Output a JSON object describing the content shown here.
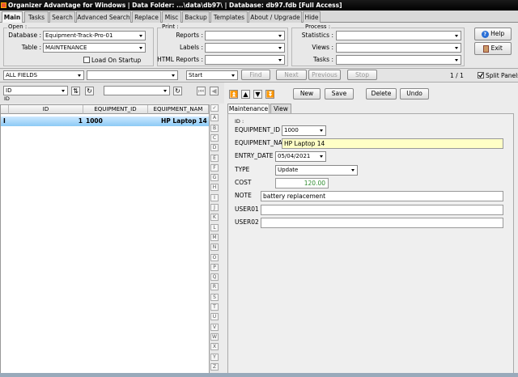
{
  "window": {
    "title": "Organizer Advantage for Windows | Data Folder: ...\\data\\db97\\ | Database: db97.fdb [Full Access]"
  },
  "main_tabs": [
    "Main",
    "Tasks",
    "Search",
    "Advanced Search",
    "Replace",
    "Misc",
    "Backup",
    "Templates",
    "About / Upgrade",
    "Hide"
  ],
  "open_group": {
    "title": "Open :",
    "database_label": "Database :",
    "database_value": "Equipment-Track-Pro-01",
    "table_label": "Table :",
    "table_value": "MAINTENANCE",
    "load_on_startup_label": "Load On Startup"
  },
  "print_group": {
    "title": "Print :",
    "reports_label": "Reports :",
    "labels_label": "Labels :",
    "html_reports_label": "HTML Reports :"
  },
  "process_group": {
    "title": "Process :",
    "statistics_label": "Statistics :",
    "views_label": "Views :",
    "tasks_label": "Tasks :"
  },
  "help_button": "Help",
  "exit_button": "Exit",
  "search": {
    "field_value": "ALL FIELDS",
    "mode_value": "Start",
    "find_button": "Find",
    "next_button": "Next",
    "previous_button": "Previous",
    "stop_button": "Stop",
    "record_counter": "1 / 1",
    "split_panels_label": "Split Panels"
  },
  "sort": {
    "field_value": "ID",
    "sub_label": "ID"
  },
  "grid": {
    "columns": [
      "ID",
      "EQUIPMENT_ID",
      "EQUIPMENT_NAM"
    ],
    "rows": [
      {
        "marker": "I",
        "id": "1",
        "equipment_id": "1000",
        "equipment_name": "HP Laptop 14"
      }
    ]
  },
  "alpha_index": [
    "✓",
    "A",
    "B",
    "C",
    "D",
    "E",
    "F",
    "G",
    "H",
    "I",
    "J",
    "K",
    "L",
    "M",
    "N",
    "O",
    "P",
    "Q",
    "R",
    "S",
    "T",
    "U",
    "V",
    "W",
    "X",
    "Y",
    "Z"
  ],
  "record_toolbar": {
    "new_button": "New",
    "save_button": "Save",
    "delete_button": "Delete",
    "undo_button": "Undo"
  },
  "form_tabs": [
    "Maintenance",
    "View"
  ],
  "form": {
    "id_label": "ID :",
    "equipment_id_label": "EQUIPMENT_ID",
    "equipment_id_value": "1000",
    "equipment_name_label": "EQUIPMENT_NA",
    "equipment_name_value": "HP Laptop 14",
    "entry_date_label": "ENTRY_DATE",
    "entry_date_value": "05/04/2021",
    "type_label": "TYPE",
    "type_value": "Update",
    "cost_label": "COST",
    "cost_value": "120.00",
    "note_label": "NOTE",
    "note_value": "battery replacement",
    "user01_label": "USER01",
    "user01_value": "",
    "user02_label": "USER02",
    "user02_value": ""
  },
  "colors": {
    "selected_row": "#8ccaf5",
    "title_bar": "#000000",
    "highlight_field": "#ffffc6",
    "cost_text": "#2e8b2e"
  }
}
